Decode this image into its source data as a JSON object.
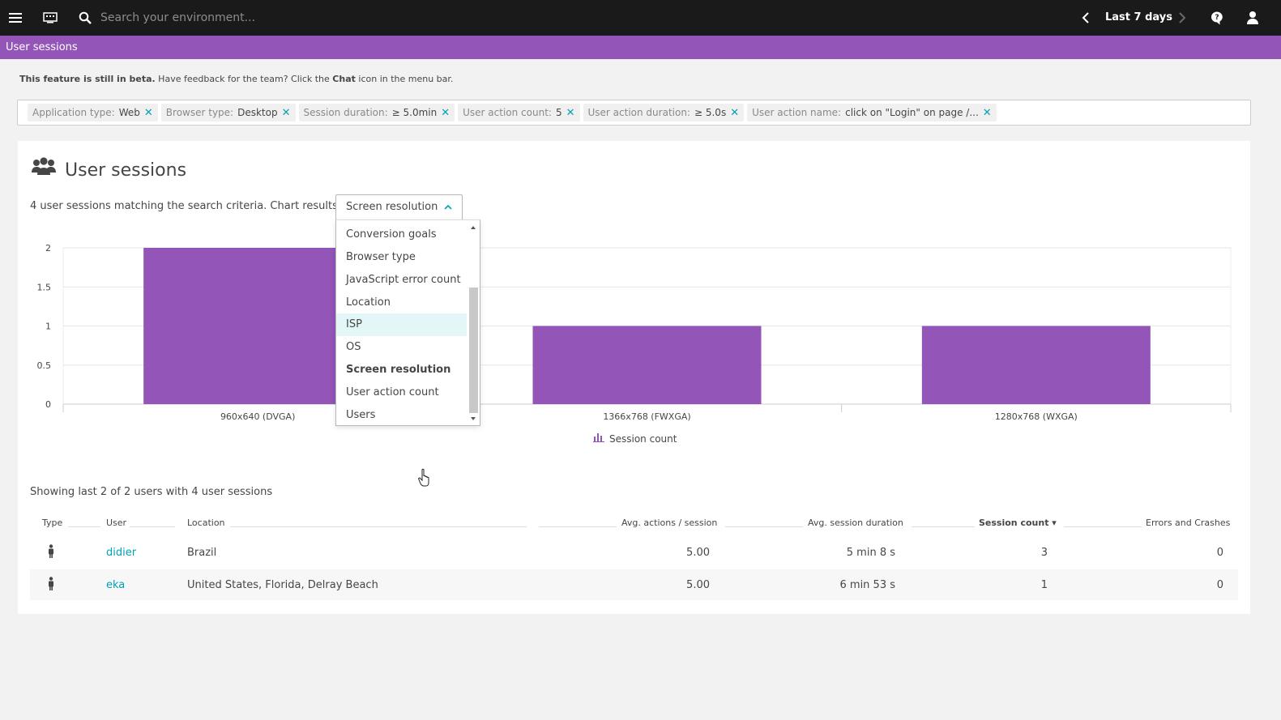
{
  "topbar": {
    "search_placeholder": "Search your environment...",
    "timeframe": "Last 7 days"
  },
  "pagebar": {
    "title": "User sessions"
  },
  "beta": {
    "bold": "This feature is still in beta.",
    "text_a": " Have feedback for the team? Click the ",
    "chat": "Chat",
    "text_b": " icon in the menu bar."
  },
  "filters": [
    {
      "key": "Application type:",
      "value": "Web"
    },
    {
      "key": "Browser type:",
      "value": "Desktop"
    },
    {
      "key": "Session duration:",
      "value": "≥ 5.0min"
    },
    {
      "key": "User action count:",
      "value": "5"
    },
    {
      "key": "User action duration:",
      "value": "≥ 5.0s"
    },
    {
      "key": "User action name:",
      "value": "click on \"Login\" on page /..."
    }
  ],
  "card": {
    "title": "User sessions",
    "match_text": "4 user sessions matching the search criteria. Chart results by",
    "chart_by_selected": "Screen resolution"
  },
  "dropdown": {
    "options": [
      "Conversion goals",
      "Browser type",
      "JavaScript error count",
      "Location",
      "ISP",
      "OS",
      "Screen resolution",
      "User action count",
      "Users"
    ],
    "hovered": "ISP",
    "selected": "Screen resolution"
  },
  "chart_data": {
    "type": "bar",
    "categories": [
      "960x640 (DVGA)",
      "1366x768 (FWXGA)",
      "1280x768 (WXGA)"
    ],
    "series": [
      {
        "name": "Session count",
        "values": [
          2,
          1,
          1
        ]
      }
    ],
    "ylim": [
      0,
      2
    ],
    "yticks": [
      "0",
      "0.5",
      "1",
      "1.5",
      "2"
    ],
    "bar_color": "#9355b7",
    "grid": true,
    "legend": "bottom-center"
  },
  "table": {
    "showing": "Showing last 2 of 2 users with 4 user sessions",
    "headers": {
      "type": "Type",
      "user": "User",
      "location": "Location",
      "avg_actions": "Avg. actions / session",
      "avg_duration": "Avg. session duration",
      "session_count": "Session count ▾",
      "errors": "Errors and Crashes"
    },
    "rows": [
      {
        "user": "didier",
        "location": "Brazil",
        "avg_actions": "5.00",
        "avg_duration": "5 min 8 s",
        "session_count": "3",
        "errors": "0"
      },
      {
        "user": "eka",
        "location": "United States, Florida, Delray Beach",
        "avg_actions": "5.00",
        "avg_duration": "6 min 53 s",
        "session_count": "1",
        "errors": "0"
      }
    ]
  },
  "colors": {
    "accent": "#9355b7",
    "link": "#00a1b2",
    "topbar": "#1a1a1a"
  }
}
